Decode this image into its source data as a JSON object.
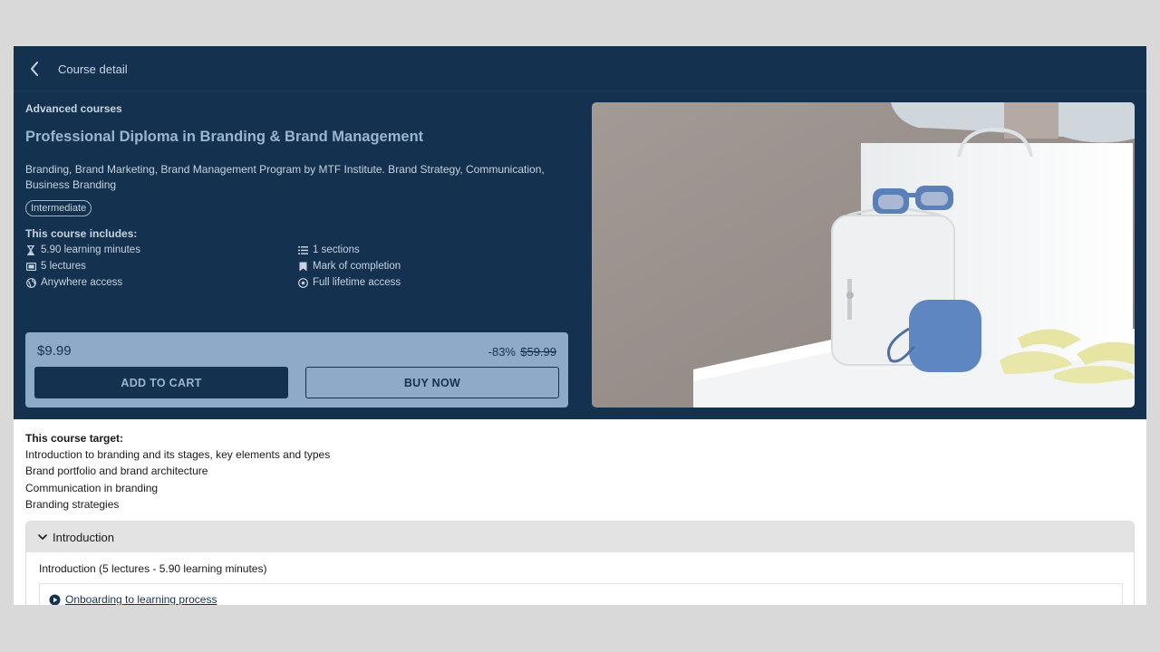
{
  "header": {
    "title": "Course detail"
  },
  "course": {
    "category": "Advanced courses",
    "title": "Professional Diploma in Branding & Brand Management",
    "subtitle": "Branding, Brand Marketing, Brand Management Program by MTF Institute. Brand Strategy, Communication, Business Branding",
    "level": "Intermediate"
  },
  "includes": {
    "title": "This course includes:",
    "items": [
      {
        "icon": "hourglass-icon",
        "label": "5.90 learning minutes"
      },
      {
        "icon": "list-icon",
        "label": "1 sections"
      },
      {
        "icon": "video-icon",
        "label": "5 lectures"
      },
      {
        "icon": "bookmark-icon",
        "label": "Mark of completion"
      },
      {
        "icon": "globe-icon",
        "label": "Anywhere access"
      },
      {
        "icon": "infinity-icon",
        "label": "Full lifetime access"
      }
    ]
  },
  "pricing": {
    "price": "$9.99",
    "discount": "-83%",
    "old_price": "$59.99",
    "add_to_cart": "ADD TO CART",
    "buy_now": "BUY NOW"
  },
  "targets": {
    "title": "This course target:",
    "items": [
      "Introduction to branding and its stages, key elements and types",
      "Brand portfolio and brand architecture",
      "Communication in branding",
      "Branding strategies"
    ]
  },
  "curriculum": {
    "section_title": "Introduction",
    "section_summary": "Introduction (5 lectures - 5.90 learning minutes)",
    "lectures": [
      "Onboarding to learning process"
    ]
  },
  "colors": {
    "hero_bg": "#14324f",
    "price_card_bg": "#8fa9c8",
    "accent_title": "#9bb4d2"
  }
}
